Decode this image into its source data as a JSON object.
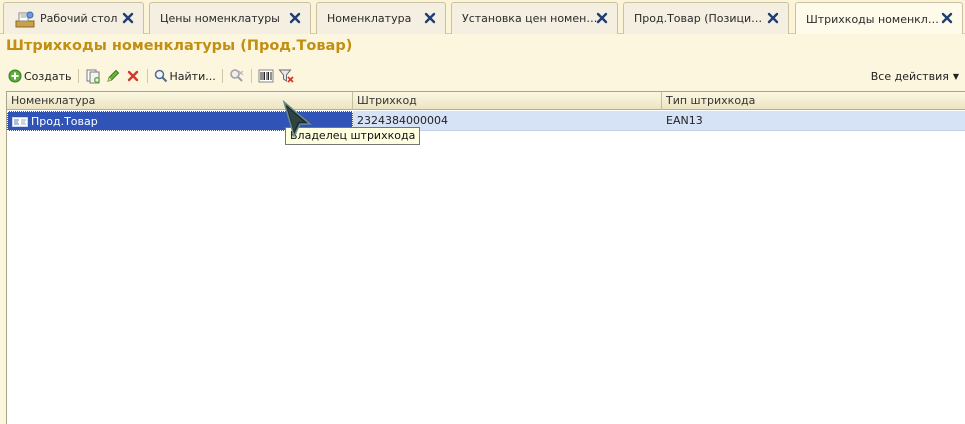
{
  "tabs": [
    {
      "label": "Рабочий стол",
      "icon": "home-desk-icon"
    },
    {
      "label": "Цены номенклатуры"
    },
    {
      "label": "Номенклатура"
    },
    {
      "label": "Установка цен номенкл..."
    },
    {
      "label": "Прод.Товар (Позиция н..."
    },
    {
      "label": "Штрихкоды номенклату..."
    }
  ],
  "form": {
    "title": "Штрихкоды номенклатуры (Прод.Товар)"
  },
  "toolbar": {
    "create_label": "Создать",
    "find_label": "Найти...",
    "all_actions_label": "Все действия",
    "icons": [
      "create-icon",
      "copy-icon",
      "edit-icon",
      "delete-icon",
      "find-icon",
      "cancel-search-icon",
      "barcode-icon",
      "filter-clear-icon"
    ]
  },
  "grid": {
    "columns": [
      "Номенклатура",
      "Штрихкод",
      "Тип штрихкода"
    ],
    "rows": [
      {
        "item": "Прод.Товар",
        "barcode": "2324384000004",
        "type": "EAN13"
      }
    ]
  },
  "tooltip": {
    "text": "Владелец штрихкода"
  },
  "colors": {
    "title": "#c28f12",
    "selected_row": "#d6e2f6",
    "selected_cell": "#2f53b7",
    "close_icon": "#1f3e75"
  }
}
